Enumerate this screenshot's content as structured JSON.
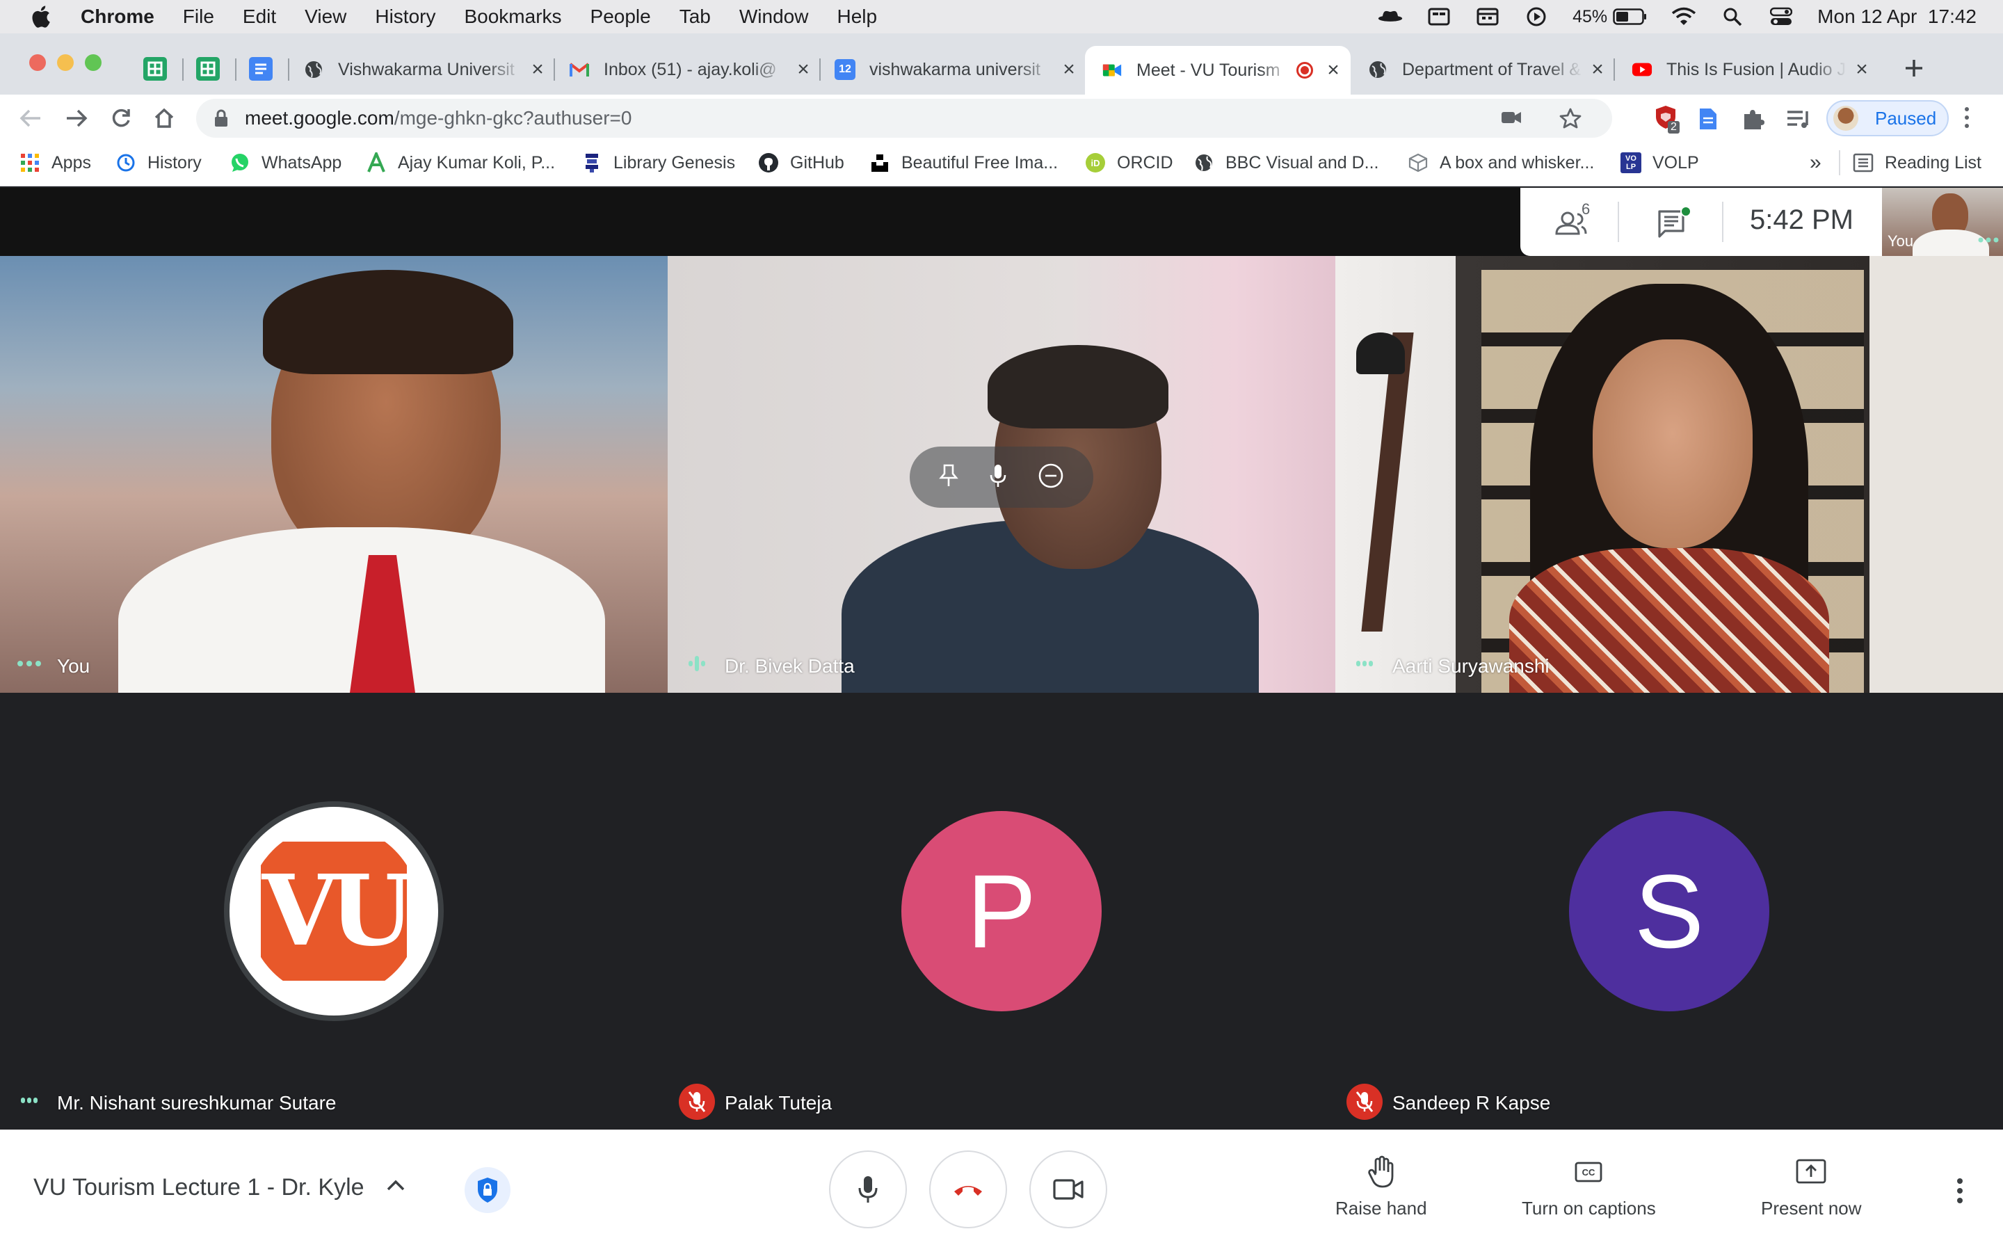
{
  "menubar": {
    "app_name": "Chrome",
    "items": [
      "File",
      "Edit",
      "View",
      "History",
      "Bookmarks",
      "People",
      "Tab",
      "Window",
      "Help"
    ],
    "battery_percent": "45%",
    "datetime": "Mon 12 Apr  17:42"
  },
  "tabs": [
    {
      "title": "Vishwakarma Universit",
      "icon": "globe-icon"
    },
    {
      "title": "Inbox (51) - ajay.koli@",
      "icon": "gmail-icon"
    },
    {
      "title": "vishwakarma universit",
      "icon": "calendar-icon"
    },
    {
      "title": "Meet - VU Tourism",
      "icon": "meet-icon",
      "active": true
    },
    {
      "title": "Department of Travel &",
      "icon": "globe-icon"
    },
    {
      "title": "This Is Fusion | Audio J",
      "icon": "youtube-icon"
    }
  ],
  "toolbar": {
    "url_host": "meet.google.com",
    "url_path": "/mge-ghkn-gkc?authuser=0",
    "extension_badge": "2",
    "profile_label": "Paused"
  },
  "bookmarks": {
    "items": [
      "Apps",
      "History",
      "WhatsApp",
      "Ajay Kumar Koli, P...",
      "Library Genesis",
      "GitHub",
      "Beautiful Free Ima...",
      "ORCID",
      "BBC Visual and D...",
      "A box and whisker...",
      "VOLP"
    ],
    "overflow": "»",
    "reading_list": "Reading List"
  },
  "meet": {
    "participant_count": "6",
    "clock": "5:42 PM",
    "self_label": "You",
    "tiles": [
      {
        "name": "You"
      },
      {
        "name": "Dr. Bivek Datta"
      },
      {
        "name": "Aarti Suryawanshi"
      },
      {
        "name": "Mr. Nishant sureshkumar Sutare",
        "logo": "VU"
      },
      {
        "name": "Palak Tuteja",
        "initial": "P",
        "color": "#d94c75",
        "muted": true
      },
      {
        "name": "Sandeep R Kapse",
        "initial": "S",
        "color": "#4e2f9e",
        "muted": true
      }
    ],
    "meeting_title": "VU Tourism Lecture 1 - Dr. Kyle",
    "actions": {
      "raise_hand": "Raise hand",
      "captions": "Turn on captions",
      "present": "Present now"
    }
  },
  "colors": {
    "meet_bg": "#202124",
    "end_call": "#d93025",
    "speaking": "#8ce2c6"
  }
}
